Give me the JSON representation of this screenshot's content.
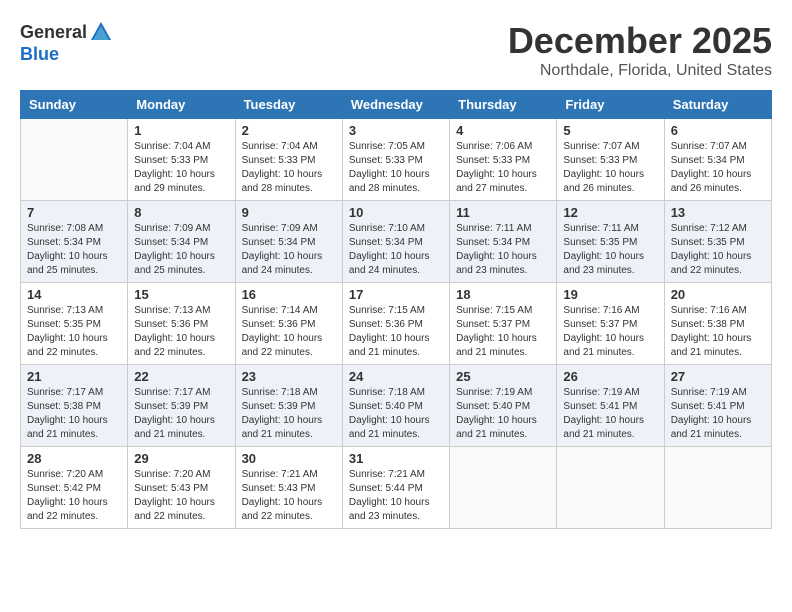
{
  "header": {
    "logo_general": "General",
    "logo_blue": "Blue",
    "month": "December 2025",
    "location": "Northdale, Florida, United States"
  },
  "weekdays": [
    "Sunday",
    "Monday",
    "Tuesday",
    "Wednesday",
    "Thursday",
    "Friday",
    "Saturday"
  ],
  "weeks": [
    [
      {
        "day": "",
        "info": ""
      },
      {
        "day": "1",
        "info": "Sunrise: 7:04 AM\nSunset: 5:33 PM\nDaylight: 10 hours\nand 29 minutes."
      },
      {
        "day": "2",
        "info": "Sunrise: 7:04 AM\nSunset: 5:33 PM\nDaylight: 10 hours\nand 28 minutes."
      },
      {
        "day": "3",
        "info": "Sunrise: 7:05 AM\nSunset: 5:33 PM\nDaylight: 10 hours\nand 28 minutes."
      },
      {
        "day": "4",
        "info": "Sunrise: 7:06 AM\nSunset: 5:33 PM\nDaylight: 10 hours\nand 27 minutes."
      },
      {
        "day": "5",
        "info": "Sunrise: 7:07 AM\nSunset: 5:33 PM\nDaylight: 10 hours\nand 26 minutes."
      },
      {
        "day": "6",
        "info": "Sunrise: 7:07 AM\nSunset: 5:34 PM\nDaylight: 10 hours\nand 26 minutes."
      }
    ],
    [
      {
        "day": "7",
        "info": "Sunrise: 7:08 AM\nSunset: 5:34 PM\nDaylight: 10 hours\nand 25 minutes."
      },
      {
        "day": "8",
        "info": "Sunrise: 7:09 AM\nSunset: 5:34 PM\nDaylight: 10 hours\nand 25 minutes."
      },
      {
        "day": "9",
        "info": "Sunrise: 7:09 AM\nSunset: 5:34 PM\nDaylight: 10 hours\nand 24 minutes."
      },
      {
        "day": "10",
        "info": "Sunrise: 7:10 AM\nSunset: 5:34 PM\nDaylight: 10 hours\nand 24 minutes."
      },
      {
        "day": "11",
        "info": "Sunrise: 7:11 AM\nSunset: 5:34 PM\nDaylight: 10 hours\nand 23 minutes."
      },
      {
        "day": "12",
        "info": "Sunrise: 7:11 AM\nSunset: 5:35 PM\nDaylight: 10 hours\nand 23 minutes."
      },
      {
        "day": "13",
        "info": "Sunrise: 7:12 AM\nSunset: 5:35 PM\nDaylight: 10 hours\nand 22 minutes."
      }
    ],
    [
      {
        "day": "14",
        "info": "Sunrise: 7:13 AM\nSunset: 5:35 PM\nDaylight: 10 hours\nand 22 minutes."
      },
      {
        "day": "15",
        "info": "Sunrise: 7:13 AM\nSunset: 5:36 PM\nDaylight: 10 hours\nand 22 minutes."
      },
      {
        "day": "16",
        "info": "Sunrise: 7:14 AM\nSunset: 5:36 PM\nDaylight: 10 hours\nand 22 minutes."
      },
      {
        "day": "17",
        "info": "Sunrise: 7:15 AM\nSunset: 5:36 PM\nDaylight: 10 hours\nand 21 minutes."
      },
      {
        "day": "18",
        "info": "Sunrise: 7:15 AM\nSunset: 5:37 PM\nDaylight: 10 hours\nand 21 minutes."
      },
      {
        "day": "19",
        "info": "Sunrise: 7:16 AM\nSunset: 5:37 PM\nDaylight: 10 hours\nand 21 minutes."
      },
      {
        "day": "20",
        "info": "Sunrise: 7:16 AM\nSunset: 5:38 PM\nDaylight: 10 hours\nand 21 minutes."
      }
    ],
    [
      {
        "day": "21",
        "info": "Sunrise: 7:17 AM\nSunset: 5:38 PM\nDaylight: 10 hours\nand 21 minutes."
      },
      {
        "day": "22",
        "info": "Sunrise: 7:17 AM\nSunset: 5:39 PM\nDaylight: 10 hours\nand 21 minutes."
      },
      {
        "day": "23",
        "info": "Sunrise: 7:18 AM\nSunset: 5:39 PM\nDaylight: 10 hours\nand 21 minutes."
      },
      {
        "day": "24",
        "info": "Sunrise: 7:18 AM\nSunset: 5:40 PM\nDaylight: 10 hours\nand 21 minutes."
      },
      {
        "day": "25",
        "info": "Sunrise: 7:19 AM\nSunset: 5:40 PM\nDaylight: 10 hours\nand 21 minutes."
      },
      {
        "day": "26",
        "info": "Sunrise: 7:19 AM\nSunset: 5:41 PM\nDaylight: 10 hours\nand 21 minutes."
      },
      {
        "day": "27",
        "info": "Sunrise: 7:19 AM\nSunset: 5:41 PM\nDaylight: 10 hours\nand 21 minutes."
      }
    ],
    [
      {
        "day": "28",
        "info": "Sunrise: 7:20 AM\nSunset: 5:42 PM\nDaylight: 10 hours\nand 22 minutes."
      },
      {
        "day": "29",
        "info": "Sunrise: 7:20 AM\nSunset: 5:43 PM\nDaylight: 10 hours\nand 22 minutes."
      },
      {
        "day": "30",
        "info": "Sunrise: 7:21 AM\nSunset: 5:43 PM\nDaylight: 10 hours\nand 22 minutes."
      },
      {
        "day": "31",
        "info": "Sunrise: 7:21 AM\nSunset: 5:44 PM\nDaylight: 10 hours\nand 23 minutes."
      },
      {
        "day": "",
        "info": ""
      },
      {
        "day": "",
        "info": ""
      },
      {
        "day": "",
        "info": ""
      }
    ]
  ]
}
